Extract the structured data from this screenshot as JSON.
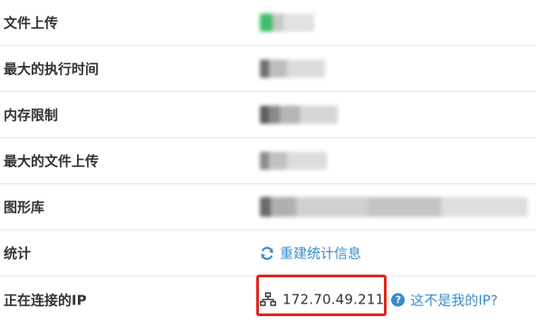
{
  "rows": [
    {
      "label": "文件上传"
    },
    {
      "label": "最大的执行时间"
    },
    {
      "label": "内存限制"
    },
    {
      "label": "最大的文件上传"
    },
    {
      "label": "图形库"
    },
    {
      "label": "统计"
    },
    {
      "label": "正在连接的IP"
    }
  ],
  "stats": {
    "refresh_icon": "refresh-icon",
    "rebuild_link": "重建统计信息"
  },
  "ip": {
    "network_icon": "network-icon",
    "address": "172.70.49.211",
    "help_icon": "question-circle-icon",
    "help_icon_glyph": "?",
    "not_my_ip_link": "这不是我的IP?"
  },
  "colors": {
    "link": "#3a8ccc",
    "highlight_box": "#e0261f",
    "status_green": "#3fbf6a"
  }
}
